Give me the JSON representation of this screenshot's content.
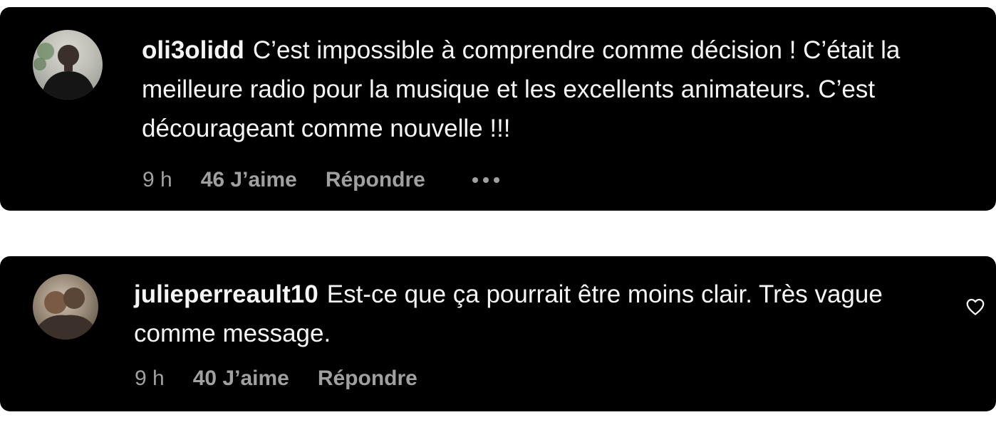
{
  "comments": [
    {
      "username": "oli3olidd",
      "text": "C’est impossible à comprendre comme décision ! C’était la meilleure radio pour la musique et les excellents animateurs. C’est décourageant comme nouvelle !!!",
      "time": "9 h",
      "likes": "46 J’aime",
      "reply": "Répondre",
      "icons": {
        "avatar": "avatar",
        "more": "more-options-icon"
      }
    },
    {
      "username": "julieperreault10",
      "text": "Est-ce que ça pourrait être moins clair. Très vague comme message.",
      "time": "9 h",
      "likes": "40 J’aime",
      "reply": "Répondre",
      "icons": {
        "avatar": "avatar",
        "like": "heart-icon"
      }
    }
  ],
  "colors": {
    "card_background": "#000000",
    "text_primary": "#f5f5f5",
    "text_secondary": "#a0a0a0"
  }
}
